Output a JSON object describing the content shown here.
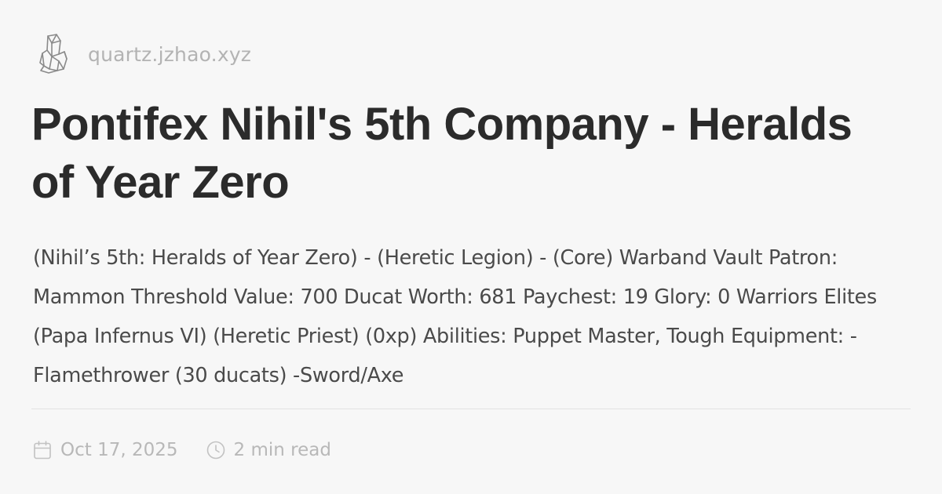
{
  "site": {
    "logo_icon": "crystal-icon",
    "domain": "quartz.jzhao.xyz"
  },
  "page": {
    "title": "Pontifex Nihil's 5th Company - Heralds of Year Zero",
    "excerpt": "(Nihil’s 5th: Heralds of Year Zero) - (Heretic Legion) - (Core) Warband Vault Patron: Mammon Threshold Value: 700 Ducat Worth: 681 Paychest: 19 Glory: 0 Warriors Elites (Papa Infernus VI) (Heretic Priest) (0xp) Abilities: Puppet Master, Tough Equipment: -Flamethrower (30 ducats) -Sword/Axe"
  },
  "meta": {
    "date_icon": "calendar-icon",
    "date": "Oct 17, 2025",
    "reading_icon": "clock-icon",
    "reading_time": "2 min read"
  },
  "colors": {
    "background": "#f7f7f7",
    "title": "#2b2b2b",
    "body_text": "#4a4a4a",
    "muted": "#b3b3b3",
    "divider": "#e2e2e2"
  }
}
